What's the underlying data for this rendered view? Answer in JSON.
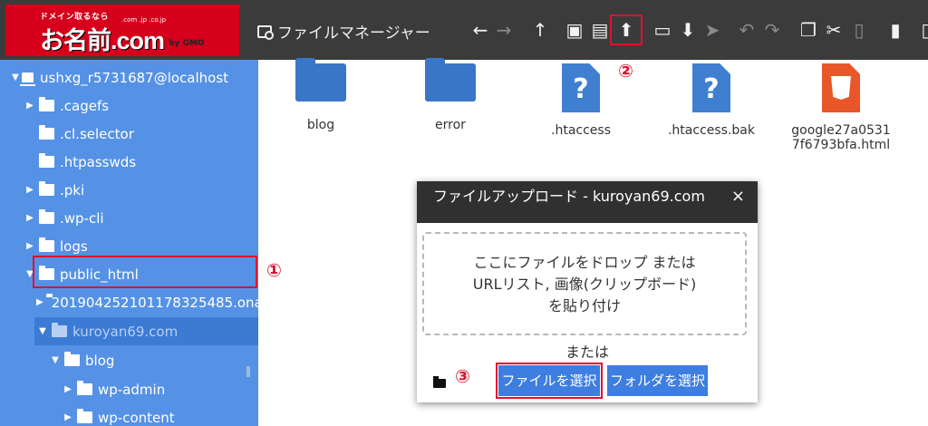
{
  "logo": {
    "tagline": "ドメイン取るなら",
    "name": "お名前.com",
    "tlds": ".com .jp .co.jp",
    "company": "by GMO"
  },
  "header": {
    "title": "ファイルマネージャー"
  },
  "toolbar": {
    "back": "←",
    "forward": "→",
    "up": "↑",
    "new_folder": "▣",
    "new_file": "▤",
    "upload": "⬆",
    "open": "▭",
    "download": "⬇",
    "select": "➤",
    "undo": "↶",
    "redo": "↷",
    "copy": "❐",
    "cut": "✂",
    "paste": "▯",
    "delete": "▮",
    "more": "▯"
  },
  "markers": {
    "one": "①",
    "two": "②",
    "three": "③"
  },
  "sidebar": {
    "root": "ushxg_r5731687@localhost",
    "items": [
      {
        "label": ".cagefs",
        "arrow": "▶"
      },
      {
        "label": ".cl.selector",
        "arrow": ""
      },
      {
        "label": ".htpasswds",
        "arrow": ""
      },
      {
        "label": ".pki",
        "arrow": "▶"
      },
      {
        "label": ".wp-cli",
        "arrow": "▶"
      },
      {
        "label": "logs",
        "arrow": "▶"
      },
      {
        "label": "public_html",
        "arrow": "▼"
      },
      {
        "label": "20190425210117832548​5.ona",
        "arrow": "▶"
      },
      {
        "label": "kuroyan69.com",
        "arrow": "▼"
      },
      {
        "label": "blog",
        "arrow": "▼"
      },
      {
        "label": "wp-admin",
        "arrow": "▶"
      },
      {
        "label": "wp-content",
        "arrow": "▶"
      }
    ]
  },
  "files": [
    {
      "name": "blog",
      "type": "folder"
    },
    {
      "name": "error",
      "type": "folder"
    },
    {
      "name": ".htaccess",
      "type": "unknown"
    },
    {
      "name": ".htaccess.bak",
      "type": "unknown"
    },
    {
      "name": "google27a05317f6793bfa.html",
      "type": "html"
    }
  ],
  "dialog": {
    "title": "ファイルアップロード - kuroyan69.com",
    "close": "×",
    "drop_line1": "ここにファイルをドロップ または",
    "drop_line2": "URLリスト, 画像(クリップボード)",
    "drop_line3": "を貼り付け",
    "or": "または",
    "select_files": "ファイルを選択",
    "select_folder": "フォルダを選択"
  }
}
